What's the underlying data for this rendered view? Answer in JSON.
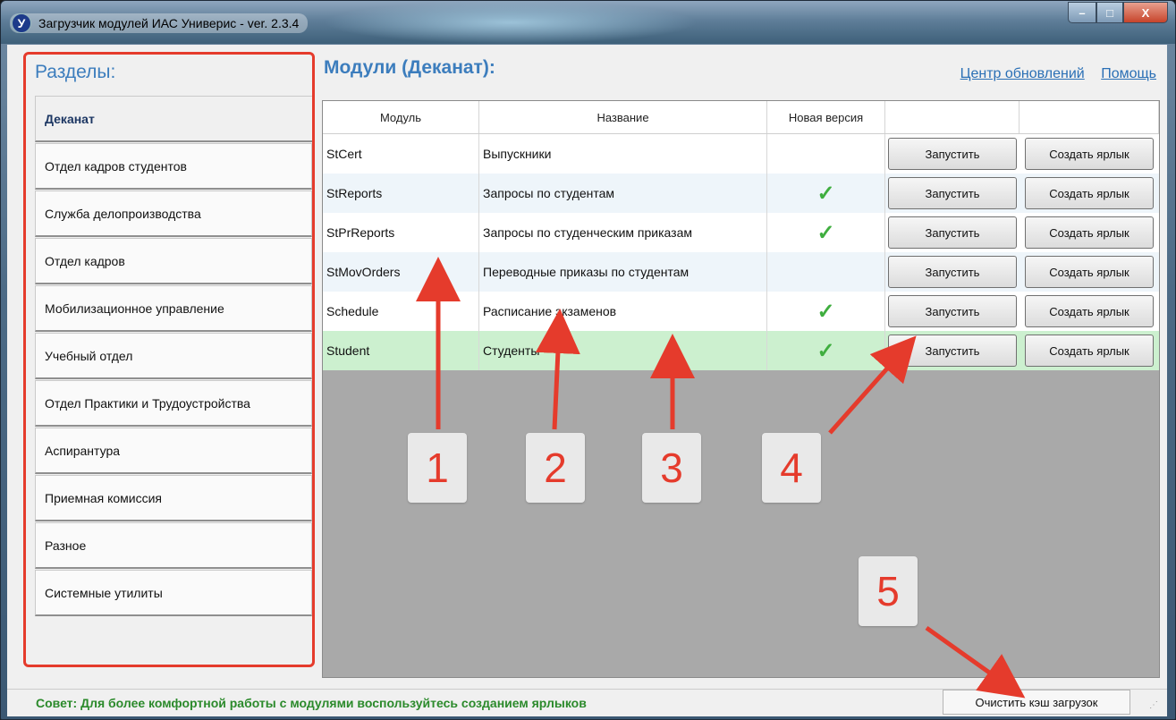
{
  "window": {
    "title": "Загрузчик модулей ИАС Универис  -  ver. 2.3.4",
    "app_icon_letter": "У",
    "controls": {
      "minimize": "–",
      "maximize": "□",
      "close": "X"
    }
  },
  "sidebar": {
    "title": "Разделы:",
    "items": [
      {
        "label": "Деканат",
        "active": true
      },
      {
        "label": "Отдел кадров студентов"
      },
      {
        "label": "Служба делопроизводства"
      },
      {
        "label": "Отдел кадров"
      },
      {
        "label": "Мобилизационное управление"
      },
      {
        "label": "Учебный отдел"
      },
      {
        "label": "Отдел Практики и Трудоустройства"
      },
      {
        "label": "Аспирантура"
      },
      {
        "label": "Приемная комиссия"
      },
      {
        "label": "Разное"
      },
      {
        "label": "Системные утилиты"
      }
    ]
  },
  "main": {
    "title": "Модули (Деканат):",
    "links": {
      "update_center": "Центр обновлений",
      "help": "Помощь"
    },
    "table": {
      "headers": [
        "Модуль",
        "Название",
        "Новая версия",
        "",
        ""
      ],
      "rows": [
        {
          "module": "StCert",
          "name": "Выпускники",
          "new_version": "",
          "run": "Запустить",
          "shortcut": "Создать ярлык"
        },
        {
          "module": "StReports",
          "name": "Запросы по студентам",
          "new_version": "✓",
          "run": "Запустить",
          "shortcut": "Создать ярлык"
        },
        {
          "module": "StPrReports",
          "name": "Запросы по студенческим приказам",
          "new_version": "✓",
          "run": "Запустить",
          "shortcut": "Создать ярлык"
        },
        {
          "module": "StMovOrders",
          "name": "Переводные приказы по студентам",
          "new_version": "",
          "run": "Запустить",
          "shortcut": "Создать ярлык"
        },
        {
          "module": "Schedule",
          "name": "Расписание экзаменов",
          "new_version": "✓",
          "run": "Запустить",
          "shortcut": "Создать ярлык"
        },
        {
          "module": "Student",
          "name": "Студенты",
          "new_version": "✓",
          "run": "Запустить",
          "shortcut": "Создать ярлык"
        }
      ]
    }
  },
  "statusbar": {
    "tip": "Совет: Для более комфортной работы с модулями воспользуйтесь созданием ярлыков",
    "clear_cache": "Очистить кэш загрузок"
  },
  "annotations": [
    "1",
    "2",
    "3",
    "4",
    "5"
  ],
  "colors": {
    "accent": "#3c7dbd",
    "highlight_border": "#e53b2c",
    "selected_row": "#ccf0cf",
    "tip_text": "#2b8a2b",
    "check": "#3fae3f"
  }
}
